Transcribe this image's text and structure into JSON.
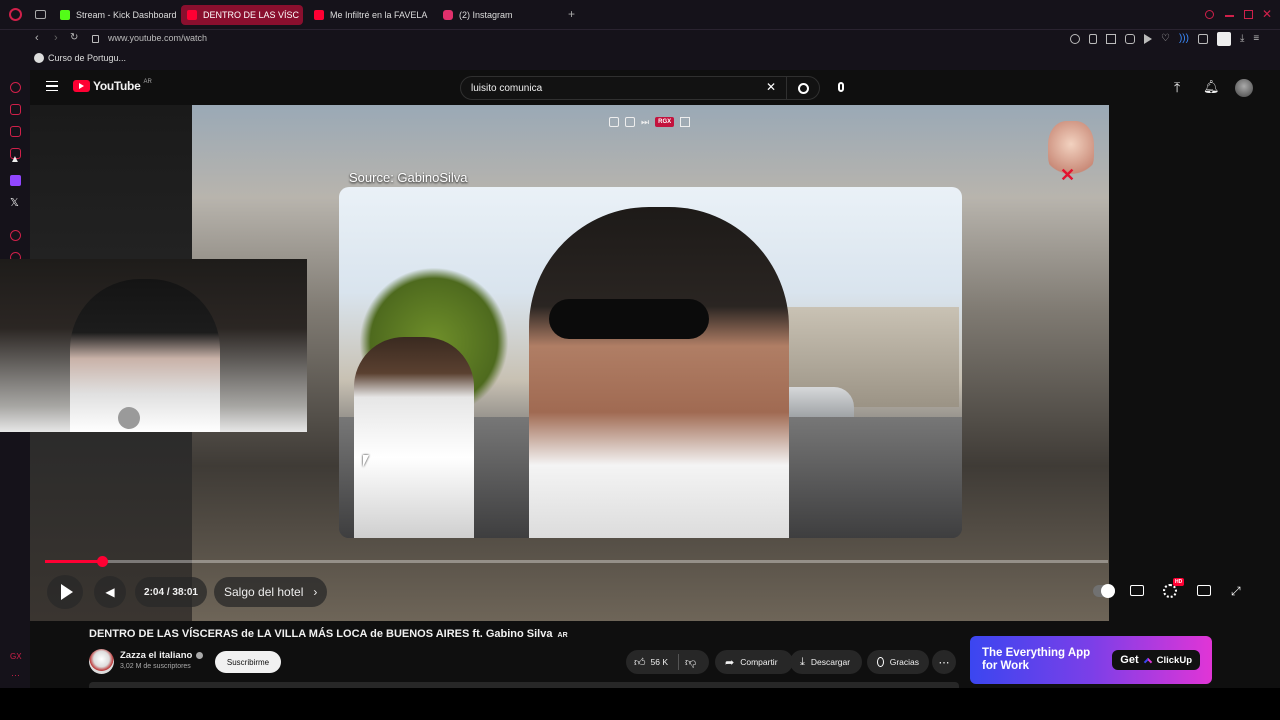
{
  "browser": {
    "tabs": [
      {
        "label": "Stream - Kick Dashboard",
        "fav_color": "#53fc18",
        "active": false
      },
      {
        "label": "DENTRO DE LAS VÍSC",
        "fav_color": "#ff0033",
        "active": true
      },
      {
        "label": "Me Infiltré en la FAVELA",
        "fav_color": "#ff0033",
        "active": false
      },
      {
        "label": "(2) Instagram",
        "fav_color": "#e1306c",
        "active": false
      }
    ],
    "url": "www.youtube.com/watch",
    "bookmark": "Curso de Portugu..."
  },
  "youtube": {
    "logo_text": "YouTube",
    "region": "AR",
    "search_value": "luisito comunica"
  },
  "player": {
    "source_caption": "Source: GabinoSilva",
    "time": "2:04 / 38:01",
    "chapter": "Salgo del hotel",
    "progress_fraction": 0.054,
    "hd_badge": "HD"
  },
  "video": {
    "title": "DENTRO DE LAS VÍSCERAS de LA VILLA MÁS LOCA de BUENOS AIRES ft. Gabino Silva",
    "title_badge": "AR",
    "channel": "Zazza el italiano",
    "subscribers": "3,02 M de suscriptores",
    "subscribe_label": "Suscribirme",
    "likes": "56 K",
    "share_label": "Compartir",
    "download_label": "Descargar",
    "thanks_label": "Gracias"
  },
  "ad": {
    "headline_line1": "The Everything App",
    "headline_line2": "for Work",
    "cta": "Get",
    "brand": "ClickUp"
  },
  "overlay_toolbar": {
    "badge": "RGX"
  },
  "colors": {
    "accent": "#ff0033",
    "opera_red": "#d0204a"
  }
}
